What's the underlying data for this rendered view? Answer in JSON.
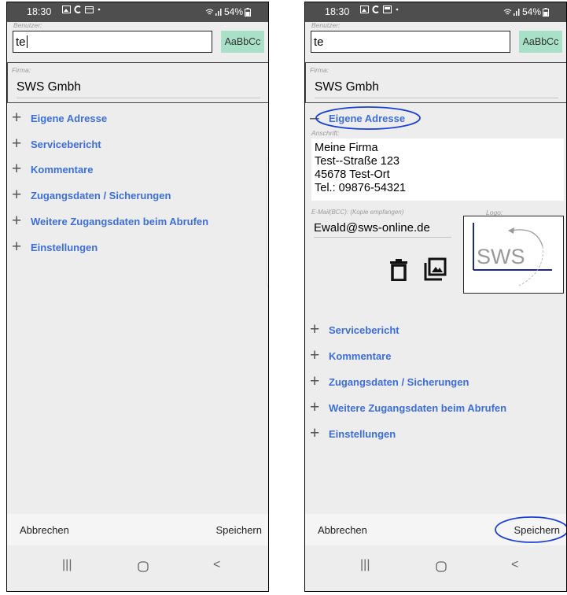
{
  "status_bar": {
    "time": "18:30",
    "battery": "54%"
  },
  "form": {
    "user_label": "Benutzer:",
    "user_value_left": "te",
    "user_value_right": "te",
    "font_button": "AaBbCc",
    "firma_label": "Firma:",
    "firma_value": "SWS Gmbh"
  },
  "sections": {
    "eigene_adresse": "Eigene Adresse",
    "servicebericht": "Servicebericht",
    "kommentare": "Kommentare",
    "zugangsdaten": "Zugangsdaten / Sicherungen",
    "weitere": "Weitere Zugangsdaten beim Abrufen",
    "einstellungen": "Einstellungen"
  },
  "expanded": {
    "anschrift_label": "Anschrift:",
    "anschrift_lines": [
      "Meine Firma",
      "Test--Straße 123",
      "45678 Test-Ort",
      "Tel.: 09876-54321"
    ],
    "email_label": "E-Mail(BCC): (Kopie empfangen)",
    "email_value": "Ewald@sws-online.de",
    "logo_label": "Logo:",
    "logo_text": "SWS"
  },
  "actions": {
    "cancel": "Abbrechen",
    "save": "Speichern"
  },
  "icons": [
    "image-icon",
    "signal-icon",
    "wifi-icon",
    "battery-icon",
    "trash-icon",
    "gallery-icon",
    "recent-apps-icon",
    "home-icon",
    "back-icon"
  ],
  "colors": {
    "section_text": "#3d6ed8",
    "font_button_bg": "#a8e0c8",
    "status_bar_bg": "#4e4e4e",
    "annotation": "#1a3fd4"
  }
}
